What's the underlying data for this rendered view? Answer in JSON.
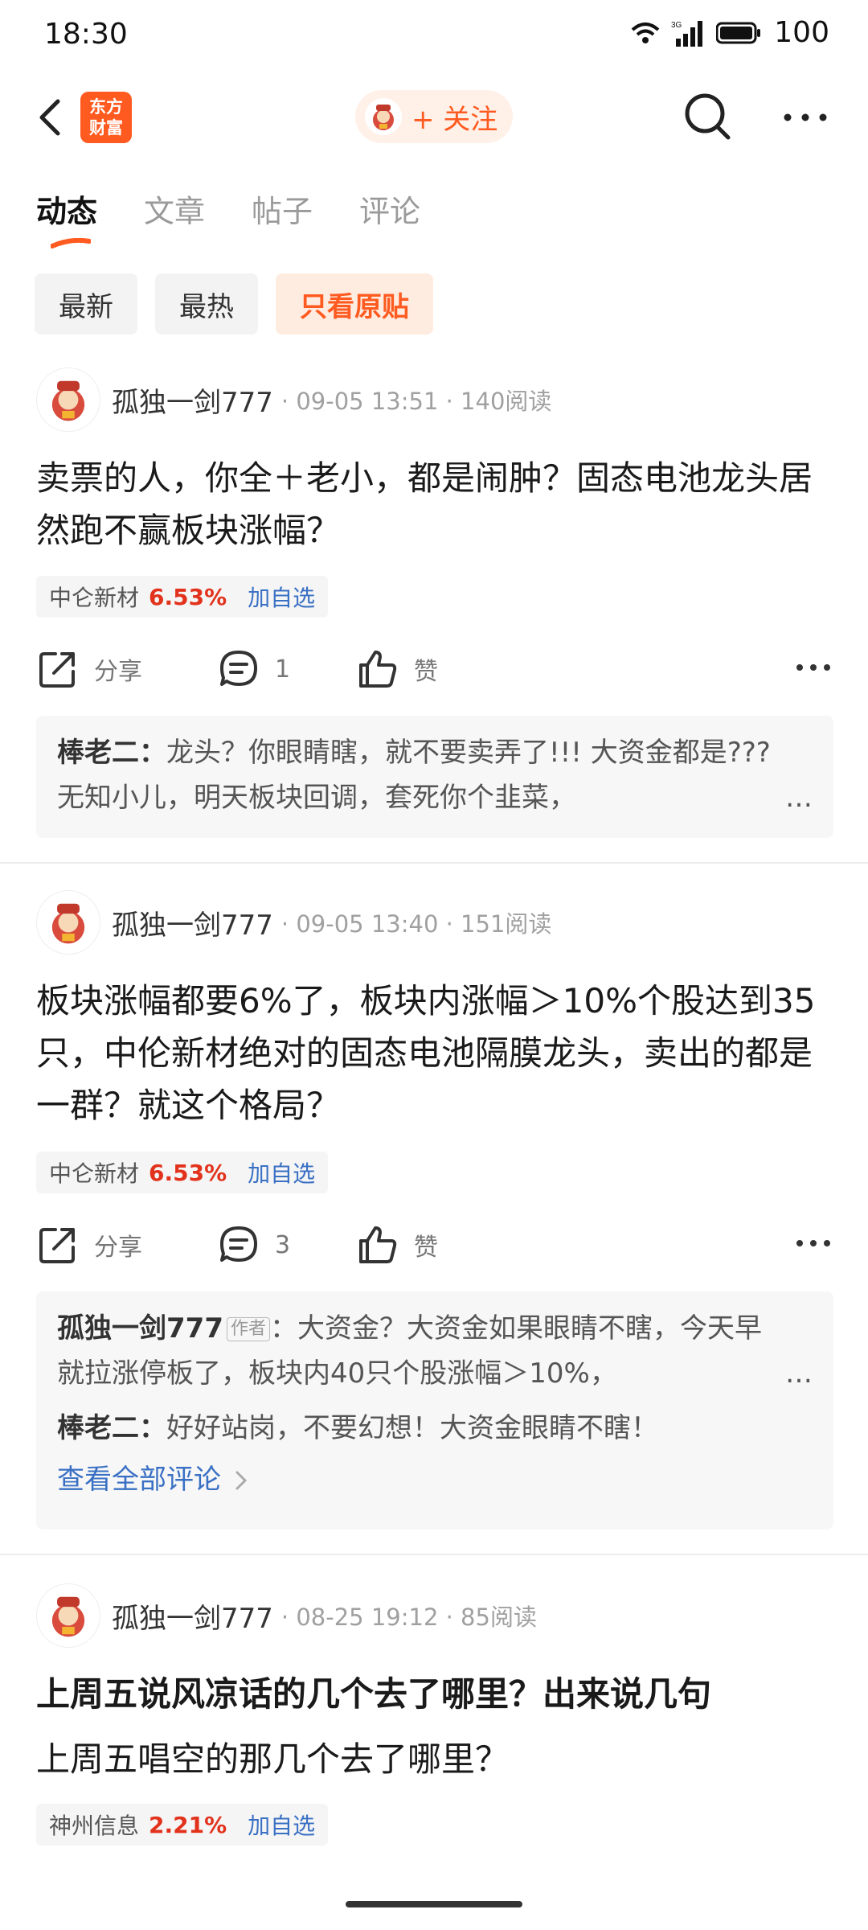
{
  "status_bar": {
    "time": "18:30",
    "battery": "100",
    "network": "3G"
  },
  "nav": {
    "logo_text": "东方财富",
    "follow_label": "+ 关注"
  },
  "tabs": [
    {
      "label": "动态"
    },
    {
      "label": "文章"
    },
    {
      "label": "帖子"
    },
    {
      "label": "评论"
    }
  ],
  "filters": [
    {
      "label": "最新"
    },
    {
      "label": "最热"
    },
    {
      "label": "只看原贴"
    }
  ],
  "posts": [
    {
      "author": "孤独一剑777",
      "meta": "· 09-05 13:51 · 140阅读",
      "text": "卖票的人，你全＋老小，都是闹肿？固态电池龙头居然跑不赢板块涨幅？",
      "stock": {
        "name": "中仑新材",
        "change": "6.53%",
        "add": "加自选"
      },
      "actions": {
        "share": "分享",
        "comments": "1",
        "like": "赞"
      },
      "comments": [
        {
          "user": "棒老二：",
          "text": "龙头？你眼睛瞎，就不要卖弄了!!!  大资金都是???  无知小儿，明天板块回调，套死你个韭菜，"
        }
      ]
    },
    {
      "author": "孤独一剑777",
      "meta": "· 09-05 13:40 · 151阅读",
      "text": "板块涨幅都要6%了，板块内涨幅＞10%个股达到35只，中伦新材绝对的固态电池隔膜龙头，卖出的都是一群？就这个格局？",
      "stock": {
        "name": "中仑新材",
        "change": "6.53%",
        "add": "加自选"
      },
      "actions": {
        "share": "分享",
        "comments": "3",
        "like": "赞"
      },
      "comments": [
        {
          "user": "孤独一剑777",
          "badge": "作者",
          "text": "：大资金？大资金如果眼睛不瞎，今天早就拉涨停板了，板块内40只个股涨幅＞10%，"
        },
        {
          "user": "棒老二：",
          "text": "好好站岗，不要幻想！大资金眼睛不瞎！"
        }
      ],
      "view_all": "查看全部评论"
    },
    {
      "author": "孤独一剑777",
      "meta": "· 08-25 19:12 · 85阅读",
      "title": "上周五说风凉话的几个去了哪里？出来说几句",
      "text": "上周五唱空的那几个去了哪里？",
      "stock": {
        "name": "神州信息",
        "change": "2.21%",
        "add": "加自选"
      }
    }
  ],
  "colors": {
    "accent": "#ff5a1f",
    "rise": "#e2321c",
    "link": "#3a70c4"
  }
}
